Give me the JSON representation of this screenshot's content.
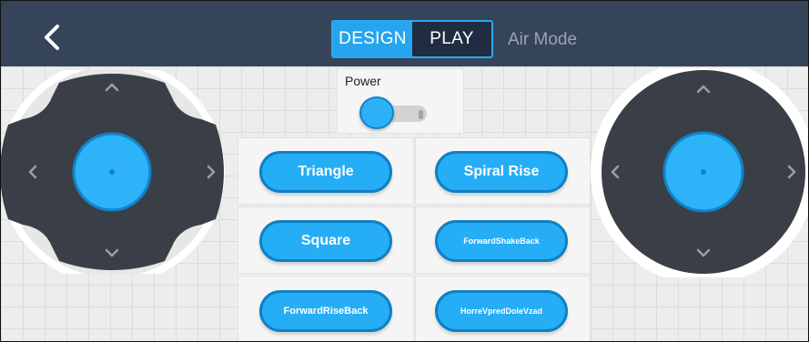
{
  "header": {
    "back_icon": "chevron-left-icon",
    "tabs": [
      {
        "label": "DESIGN",
        "active": true
      },
      {
        "label": "PLAY",
        "active": false
      }
    ],
    "mode_title": "Air Mode"
  },
  "power": {
    "label": "Power",
    "state": "off"
  },
  "actions": [
    {
      "label": "Triangle"
    },
    {
      "label": "Spiral Rise"
    },
    {
      "label": "Square"
    },
    {
      "label": "ForwardShakeBack"
    },
    {
      "label": "ForwardRiseBack"
    },
    {
      "label": "HorreVpredDoleVzad"
    }
  ],
  "joysticks": {
    "left": {
      "icons": [
        "chevron-up-icon",
        "chevron-down-icon",
        "chevron-left-icon",
        "chevron-right-icon"
      ]
    },
    "right": {
      "icons": [
        "chevron-up-icon",
        "chevron-down-icon",
        "chevron-left-icon",
        "chevron-right-icon"
      ]
    }
  },
  "colors": {
    "header_bg": "#364459",
    "accent": "#26a5ee",
    "button_fill": "#25adf5",
    "button_border": "#0f80c4",
    "joystick_pad": "#3a3f47"
  }
}
